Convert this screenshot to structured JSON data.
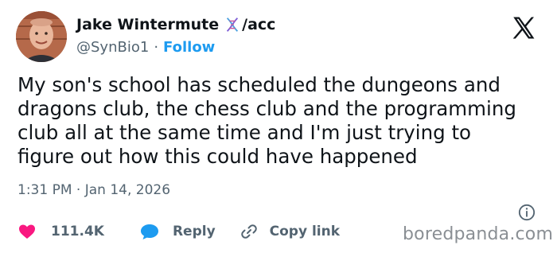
{
  "author": {
    "display_name": "Jake Wintermute",
    "name_suffix": "/acc",
    "handle": "@SynBio1",
    "separator": "·",
    "follow_label": "Follow",
    "badge_icon": "dna-icon",
    "avatar_icon": "avatar"
  },
  "platform_icon": "x-logo-icon",
  "tweet": {
    "text": "My son's school has scheduled the dungeons and\ndragons club, the chess club and the programming\nclub all at the same time and I'm just trying to\nfigure out how this could have happened",
    "timestamp": "1:31 PM · Jan 14, 2026"
  },
  "actions": {
    "like_count": "111.4K",
    "reply_label": "Reply",
    "copy_label": "Copy link"
  },
  "watermark": "boredpanda.com",
  "colors": {
    "text": "#0f1419",
    "secondary": "#536471",
    "link": "#1d9bf0",
    "like": "#f91880",
    "reply": "#1d9bf0"
  }
}
